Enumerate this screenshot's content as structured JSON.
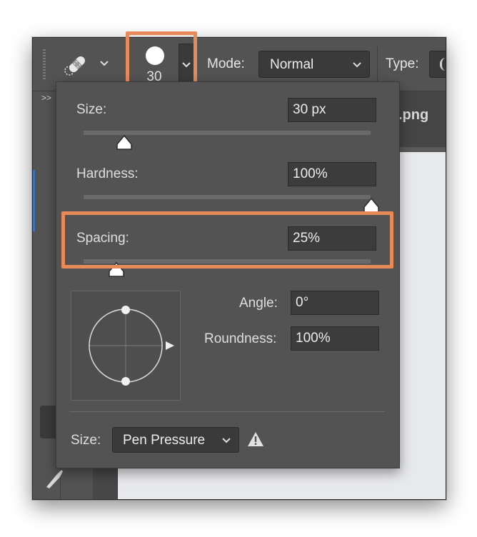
{
  "options_bar": {
    "brush_size": "30",
    "mode_label": "Mode:",
    "mode_value": "Normal",
    "type_label": "Type:"
  },
  "document_tab": {
    "title": ".png"
  },
  "brush_panel": {
    "size_label": "Size:",
    "size_value": "30 px",
    "hardness_label": "Hardness:",
    "hardness_value": "100%",
    "hardness_level_percent": 100,
    "spacing_label": "Spacing:",
    "spacing_value": "25%",
    "angle_label": "Angle:",
    "angle_value": "0°",
    "roundness_label": "Roundness:",
    "roundness_value": "100%",
    "pressure_size_label": "Size:",
    "pressure_size_value": "Pen Pressure"
  },
  "toolbar": {
    "collapse_glyph": ">>"
  },
  "colors": {
    "highlight": "#e8895a",
    "panel": "#535353",
    "field": "#3c3c3c"
  }
}
